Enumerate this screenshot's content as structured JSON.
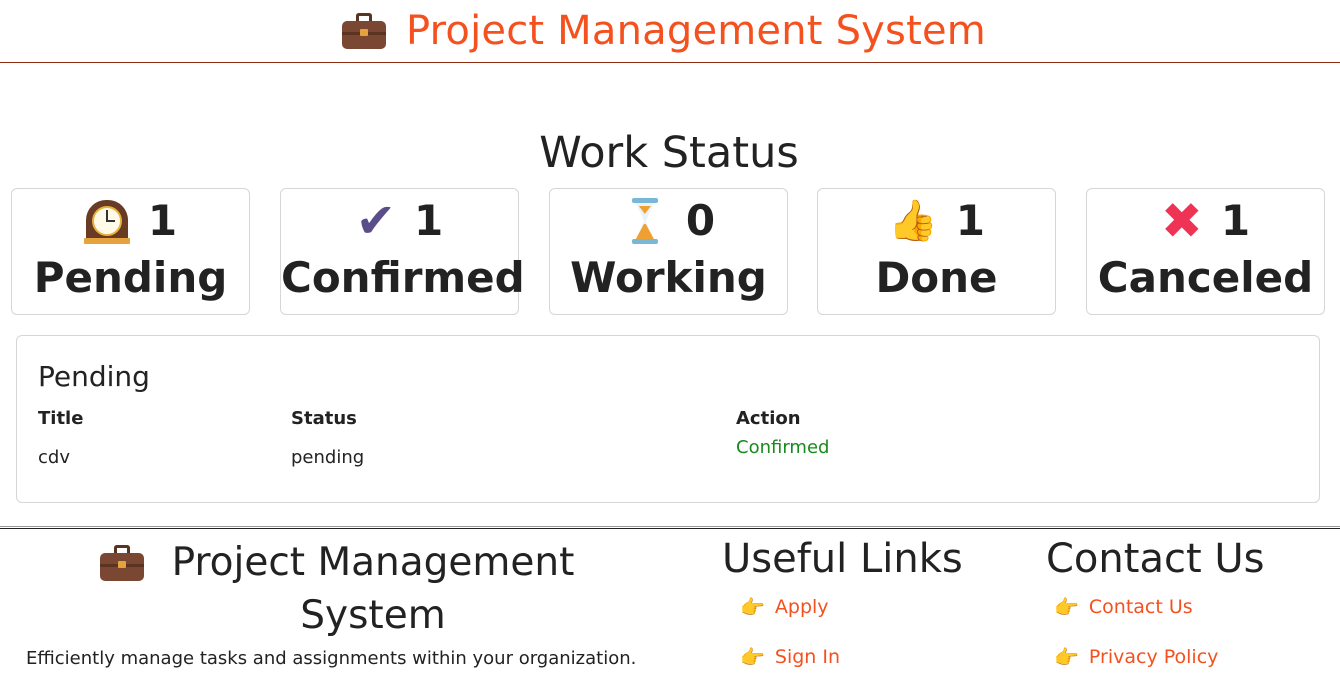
{
  "header": {
    "icon": "briefcase-icon",
    "title": "Project Management System",
    "accent_color": "#f4511e"
  },
  "work_status": {
    "title": "Work Status",
    "cards": [
      {
        "icon": "mantelpiece-clock-icon",
        "count": "1",
        "label": "Pending"
      },
      {
        "icon": "check-mark-icon",
        "count": "1",
        "label": "Confirmed"
      },
      {
        "icon": "hourglass-icon",
        "count": "0",
        "label": "Working"
      },
      {
        "icon": "thumbs-up-icon",
        "count": "1",
        "label": "Done"
      },
      {
        "icon": "cross-mark-icon",
        "count": "1",
        "label": "Canceled"
      }
    ]
  },
  "pending_panel": {
    "title": "Pending",
    "columns": [
      "Title",
      "Status",
      "Action"
    ],
    "rows": [
      {
        "title": "cdv",
        "status": "pending",
        "action": "Confirmed"
      }
    ],
    "action_color": "#198a1e"
  },
  "footer": {
    "brand_icon": "briefcase-icon",
    "brand_title": "Project Management System",
    "description": "Efficiently manage tasks and assignments within your organization.",
    "useful_links": {
      "heading": "Useful Links",
      "items": [
        "Apply",
        "Sign In"
      ]
    },
    "contact": {
      "heading": "Contact Us",
      "items": [
        "Contact Us",
        "Privacy Policy"
      ]
    },
    "link_icon": "pointing-hand-icon"
  }
}
